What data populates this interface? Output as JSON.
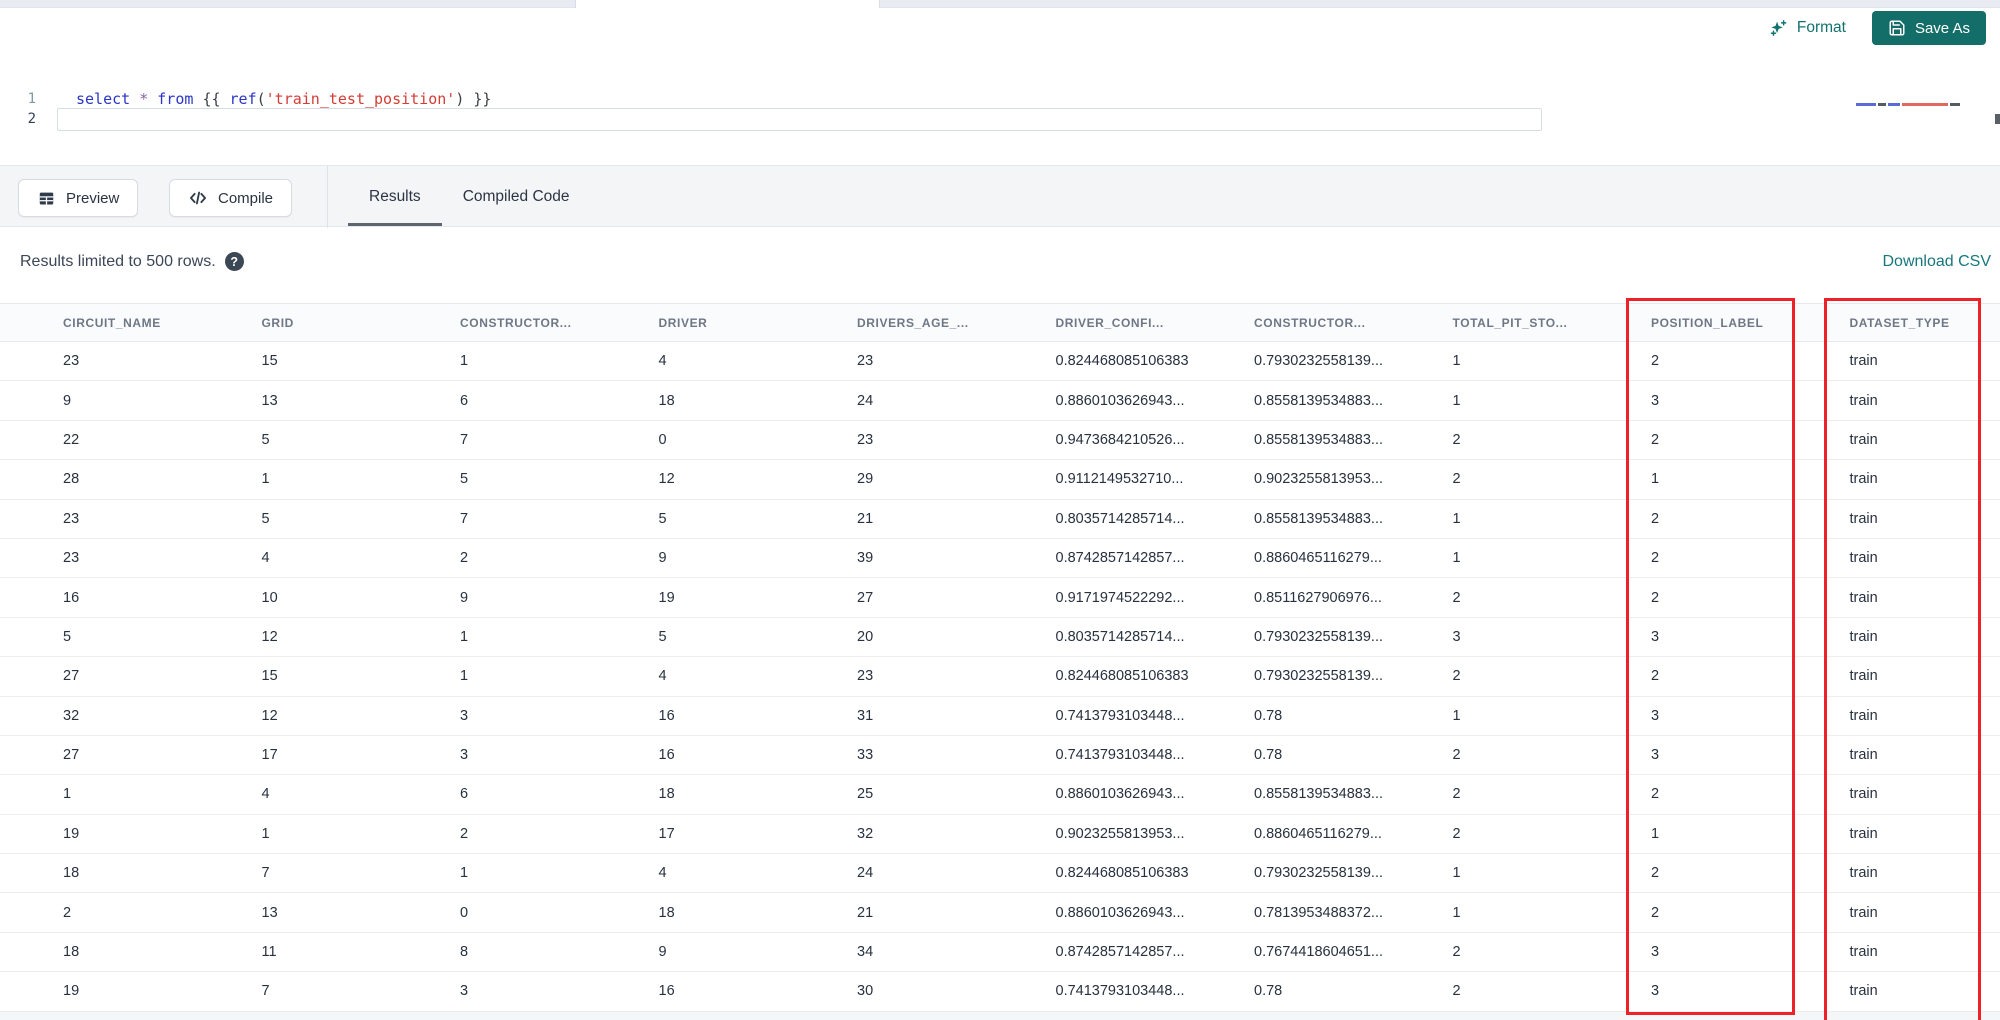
{
  "top_bar": {
    "format_label": "Format",
    "save_as_label": "Save As"
  },
  "icons": {
    "format": "sparkles-icon",
    "save_as": "floppy-disk-icon",
    "preview": "table-grid-icon",
    "compile": "code-brackets-icon",
    "help": "question-mark-icon"
  },
  "colors": {
    "accent_teal": "#136d68",
    "link_teal": "#17777e",
    "highlight_red": "#ee2028",
    "keyword_blue": "#2a35c8",
    "string_red": "#d43d35"
  },
  "editor": {
    "lines": [
      {
        "number": "1",
        "tokens": [
          {
            "text": "select",
            "type": "kw"
          },
          {
            "text": " ",
            "type": "jinja"
          },
          {
            "text": "*",
            "type": "op"
          },
          {
            "text": " ",
            "type": "jinja"
          },
          {
            "text": "from",
            "type": "kw"
          },
          {
            "text": " ",
            "type": "jinja"
          },
          {
            "text": "{{ ",
            "type": "jinja"
          },
          {
            "text": "ref",
            "type": "fn"
          },
          {
            "text": "(",
            "type": "paren"
          },
          {
            "text": "'train_test_position'",
            "type": "str"
          },
          {
            "text": ")",
            "type": "paren"
          },
          {
            "text": " }}",
            "type": "jinja"
          }
        ]
      },
      {
        "number": "2",
        "tokens": []
      }
    ]
  },
  "action_bar": {
    "preview_label": "Preview",
    "compile_label": "Compile"
  },
  "tabs": [
    {
      "label": "Results",
      "active": true
    },
    {
      "label": "Compiled Code",
      "active": false
    }
  ],
  "results_bar": {
    "info_text": "Results limited to 500 rows.",
    "help_glyph": "?",
    "download_label": "Download CSV"
  },
  "table": {
    "headers": [
      "CIRCUIT_NAME",
      "GRID",
      "CONSTRUCTOR...",
      "DRIVER",
      "DRIVERS_AGE_...",
      "DRIVER_CONFI...",
      "CONSTRUCTOR...",
      "TOTAL_PIT_STO...",
      "POSITION_LABEL",
      "DATASET_TYPE"
    ],
    "highlighted_columns": [
      "POSITION_LABEL",
      "DATASET_TYPE"
    ],
    "rows": [
      [
        "23",
        "15",
        "1",
        "4",
        "23",
        "0.824468085106383",
        "0.7930232558139...",
        "1",
        "2",
        "train"
      ],
      [
        "9",
        "13",
        "6",
        "18",
        "24",
        "0.8860103626943...",
        "0.8558139534883...",
        "1",
        "3",
        "train"
      ],
      [
        "22",
        "5",
        "7",
        "0",
        "23",
        "0.9473684210526...",
        "0.8558139534883...",
        "2",
        "2",
        "train"
      ],
      [
        "28",
        "1",
        "5",
        "12",
        "29",
        "0.9112149532710...",
        "0.9023255813953...",
        "2",
        "1",
        "train"
      ],
      [
        "23",
        "5",
        "7",
        "5",
        "21",
        "0.8035714285714...",
        "0.8558139534883...",
        "1",
        "2",
        "train"
      ],
      [
        "23",
        "4",
        "2",
        "9",
        "39",
        "0.8742857142857...",
        "0.8860465116279...",
        "1",
        "2",
        "train"
      ],
      [
        "16",
        "10",
        "9",
        "19",
        "27",
        "0.9171974522292...",
        "0.8511627906976...",
        "2",
        "2",
        "train"
      ],
      [
        "5",
        "12",
        "1",
        "5",
        "20",
        "0.8035714285714...",
        "0.7930232558139...",
        "3",
        "3",
        "train"
      ],
      [
        "27",
        "15",
        "1",
        "4",
        "23",
        "0.824468085106383",
        "0.7930232558139...",
        "2",
        "2",
        "train"
      ],
      [
        "32",
        "12",
        "3",
        "16",
        "31",
        "0.7413793103448...",
        "0.78",
        "1",
        "3",
        "train"
      ],
      [
        "27",
        "17",
        "3",
        "16",
        "33",
        "0.7413793103448...",
        "0.78",
        "2",
        "3",
        "train"
      ],
      [
        "1",
        "4",
        "6",
        "18",
        "25",
        "0.8860103626943...",
        "0.8558139534883...",
        "2",
        "2",
        "train"
      ],
      [
        "19",
        "1",
        "2",
        "17",
        "32",
        "0.9023255813953...",
        "0.8860465116279...",
        "2",
        "1",
        "train"
      ],
      [
        "18",
        "7",
        "1",
        "4",
        "24",
        "0.824468085106383",
        "0.7930232558139...",
        "1",
        "2",
        "train"
      ],
      [
        "2",
        "13",
        "0",
        "18",
        "21",
        "0.8860103626943...",
        "0.7813953488372...",
        "1",
        "2",
        "train"
      ],
      [
        "18",
        "11",
        "8",
        "9",
        "34",
        "0.8742857142857...",
        "0.7674418604651...",
        "2",
        "3",
        "train"
      ],
      [
        "19",
        "7",
        "3",
        "16",
        "30",
        "0.7413793103448...",
        "0.78",
        "2",
        "3",
        "train"
      ]
    ]
  }
}
